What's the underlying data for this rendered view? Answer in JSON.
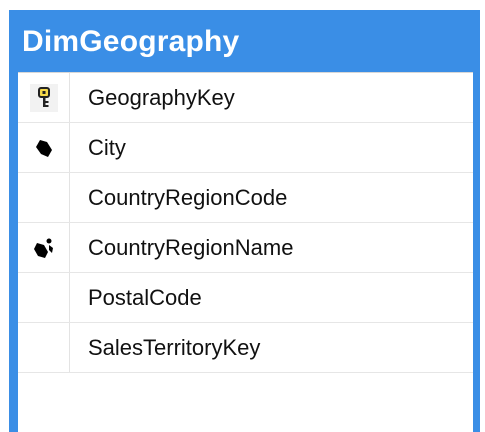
{
  "table": {
    "title": "DimGeography",
    "columns": [
      {
        "label": "GeographyKey",
        "icon": "primary-key-icon"
      },
      {
        "label": "City",
        "icon": "hierarchy-leaf-icon"
      },
      {
        "label": "CountryRegionCode",
        "icon": ""
      },
      {
        "label": "CountryRegionName",
        "icon": "hierarchy-icon"
      },
      {
        "label": "PostalCode",
        "icon": ""
      },
      {
        "label": "SalesTerritoryKey",
        "icon": ""
      }
    ]
  },
  "colors": {
    "header": "#3a8ee6",
    "key_icon": "#f6d94a"
  }
}
